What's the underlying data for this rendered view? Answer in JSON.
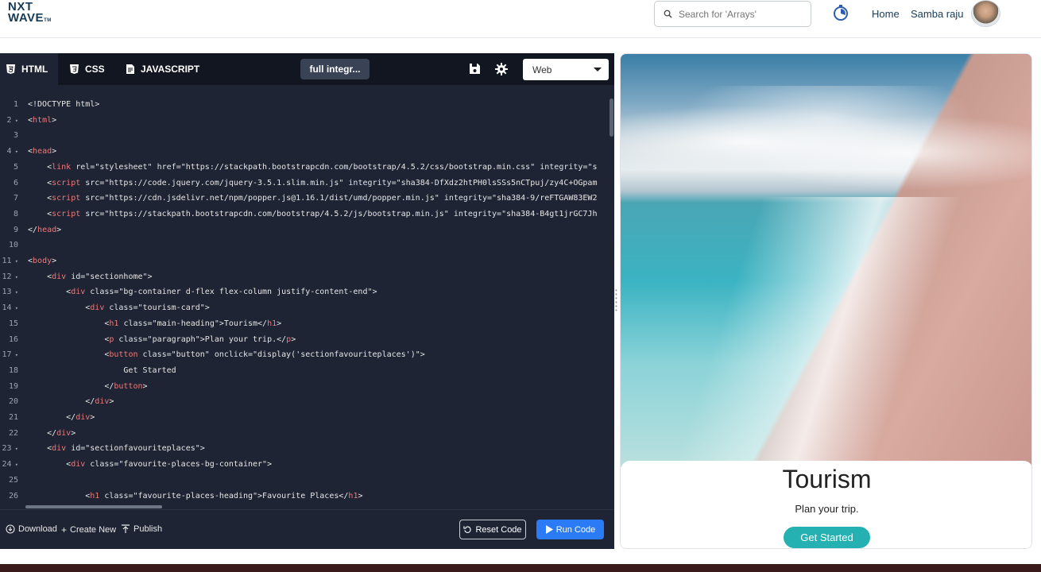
{
  "header": {
    "logo_line1": "NXT",
    "logo_line2": "WAVE",
    "logo_tm": "TM",
    "search_placeholder": "Search for 'Arrays'",
    "nav_home": "Home",
    "user_name": "Samba raju"
  },
  "editor": {
    "tabs": [
      "HTML",
      "CSS",
      "JAVASCRIPT"
    ],
    "file_name": "full integr...",
    "view_select": "Web",
    "lines": [
      {
        "n": "1",
        "fold": false,
        "html": "&lt;!DOCTYPE html&gt;"
      },
      {
        "n": "2",
        "fold": true,
        "html": "&lt;<span class=t>html</span>&gt;"
      },
      {
        "n": "3",
        "fold": false,
        "html": ""
      },
      {
        "n": "4",
        "fold": true,
        "html": "&lt;<span class=t>head</span>&gt;"
      },
      {
        "n": "5",
        "fold": false,
        "html": "    &lt;<span class=t>link</span> <span class=a>rel</span>=\"stylesheet\" <span class=a>href</span>=\"https://stackpath.bootstrapcdn.com/bootstrap/4.5.2/css/bootstrap.min.css\" <span class=a>integrity</span>=\"s"
      },
      {
        "n": "6",
        "fold": false,
        "html": "    &lt;<span class=t>script</span> <span class=a>src</span>=\"https://code.jquery.com/jquery-3.5.1.slim.min.js\" <span class=a>integrity</span>=\"sha384-DfXdz2htPH0lsSSs5nCTpuj/zy4C+OGpam"
      },
      {
        "n": "7",
        "fold": false,
        "html": "    &lt;<span class=t>script</span> <span class=a>src</span>=\"https://cdn.jsdelivr.net/npm/popper.js@1.16.1/dist/umd/popper.min.js\" <span class=a>integrity</span>=\"sha384-9/reFTGAW83EW2"
      },
      {
        "n": "8",
        "fold": false,
        "html": "    &lt;<span class=t>script</span> <span class=a>src</span>=\"https://stackpath.bootstrapcdn.com/bootstrap/4.5.2/js/bootstrap.min.js\" <span class=a>integrity</span>=\"sha384-B4gt1jrGC7Jh"
      },
      {
        "n": "9",
        "fold": false,
        "html": "&lt;/<span class=t>head</span>&gt;"
      },
      {
        "n": "10",
        "fold": false,
        "html": ""
      },
      {
        "n": "11",
        "fold": true,
        "html": "&lt;<span class=t>body</span>&gt;"
      },
      {
        "n": "12",
        "fold": true,
        "html": "    &lt;<span class=t>div</span> <span class=a>id</span>=\"sectionhome\"&gt;"
      },
      {
        "n": "13",
        "fold": true,
        "html": "        &lt;<span class=t>div</span> <span class=a>class</span>=\"bg-container d-flex flex-column justify-content-end\"&gt;"
      },
      {
        "n": "14",
        "fold": true,
        "html": "            &lt;<span class=t>div</span> <span class=a>class</span>=\"tourism-card\"&gt;"
      },
      {
        "n": "15",
        "fold": false,
        "html": "                &lt;<span class=t>h1</span> <span class=a>class</span>=\"main-heading\"&gt;Tourism&lt;/<span class=t>h1</span>&gt;"
      },
      {
        "n": "16",
        "fold": false,
        "html": "                &lt;<span class=t>p</span> <span class=a>class</span>=\"paragraph\"&gt;Plan your trip.&lt;/<span class=t>p</span>&gt;"
      },
      {
        "n": "17",
        "fold": true,
        "html": "                &lt;<span class=t>button</span> <span class=a>class</span>=\"button\" <span class=a>onclick</span>=\"display('sectionfavouriteplaces')\"&gt;"
      },
      {
        "n": "18",
        "fold": false,
        "html": "                    Get Started"
      },
      {
        "n": "19",
        "fold": false,
        "html": "                &lt;/<span class=t>button</span>&gt;"
      },
      {
        "n": "20",
        "fold": false,
        "html": "            &lt;/<span class=t>div</span>&gt;"
      },
      {
        "n": "21",
        "fold": false,
        "html": "        &lt;/<span class=t>div</span>&gt;"
      },
      {
        "n": "22",
        "fold": false,
        "html": "    &lt;/<span class=t>div</span>&gt;"
      },
      {
        "n": "23",
        "fold": true,
        "html": "    &lt;<span class=t>div</span> <span class=a>id</span>=\"sectionfavouriteplaces\"&gt;"
      },
      {
        "n": "24",
        "fold": true,
        "html": "        &lt;<span class=t>div</span> <span class=a>class</span>=\"favourite-places-bg-container\"&gt;"
      },
      {
        "n": "25",
        "fold": false,
        "html": ""
      },
      {
        "n": "26",
        "fold": false,
        "html": "            &lt;<span class=t>h1</span> <span class=a>class</span>=\"favourite-places-heading\"&gt;Favourite Places&lt;/<span class=t>h1</span>&gt;"
      }
    ]
  },
  "footer": {
    "download": "Download",
    "create_new": "Create New",
    "publish": "Publish",
    "reset_code": "Reset Code",
    "run_code": "Run Code"
  },
  "preview": {
    "heading": "Tourism",
    "paragraph": "Plan your trip.",
    "button": "Get Started"
  }
}
